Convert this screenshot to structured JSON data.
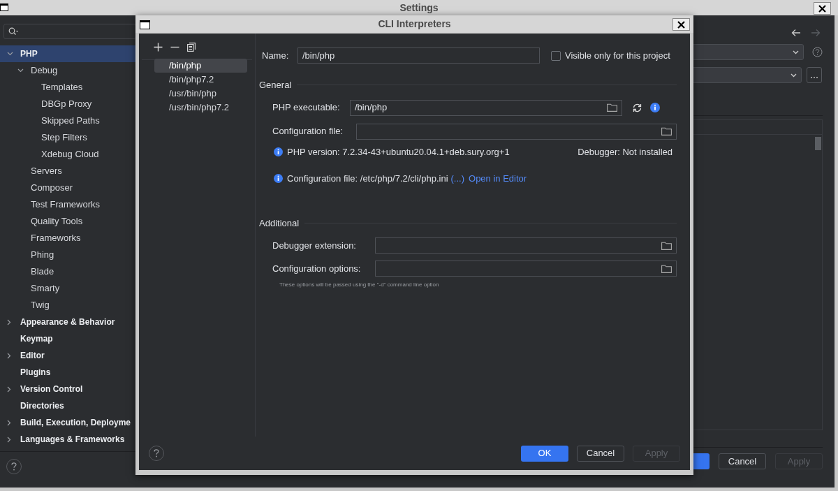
{
  "settings": {
    "title": "Settings",
    "sidebar": {
      "items": [
        {
          "label": "PHP",
          "expanded": true,
          "selected": true,
          "children": [
            {
              "label": "Debug",
              "expanded": true,
              "selected": false,
              "children": [
                {
                  "label": "Templates",
                  "selected": false
                },
                {
                  "label": "DBGp Proxy",
                  "selected": false
                },
                {
                  "label": "Skipped Paths",
                  "selected": false
                },
                {
                  "label": "Step Filters",
                  "selected": false
                },
                {
                  "label": "Xdebug Cloud",
                  "selected": false
                }
              ]
            },
            {
              "label": "Servers",
              "selected": false
            },
            {
              "label": "Composer",
              "selected": false
            },
            {
              "label": "Test Frameworks",
              "selected": false
            },
            {
              "label": "Quality Tools",
              "selected": false
            },
            {
              "label": "Frameworks",
              "selected": false
            },
            {
              "label": "Phing",
              "selected": false
            },
            {
              "label": "Blade",
              "selected": false
            },
            {
              "label": "Smarty",
              "selected": false
            },
            {
              "label": "Twig",
              "selected": false
            }
          ]
        },
        {
          "label": "Appearance & Behavior",
          "expanded": false,
          "selected": false
        },
        {
          "label": "Keymap",
          "selected": false
        },
        {
          "label": "Editor",
          "expanded": false,
          "selected": false
        },
        {
          "label": "Plugins",
          "selected": false
        },
        {
          "label": "Version Control",
          "expanded": false,
          "selected": false
        },
        {
          "label": "Directories",
          "selected": false
        },
        {
          "label": "Build, Execution, Deployme",
          "expanded": false,
          "selected": false
        },
        {
          "label": "Languages & Frameworks",
          "expanded": false,
          "selected": false
        }
      ]
    },
    "buttons": [
      {
        "label": "Cancel",
        "disabled": false
      },
      {
        "label": "Apply",
        "disabled": true
      }
    ]
  },
  "dialog": {
    "title": "CLI Interpreters",
    "interpreters": [
      {
        "label": "/bin/php",
        "selected": true
      },
      {
        "label": "/bin/php7.2",
        "selected": false
      },
      {
        "label": "/usr/bin/php",
        "selected": false
      },
      {
        "label": "/usr/bin/php7.2",
        "selected": false
      }
    ],
    "name": {
      "label": "Name:",
      "value": "/bin/php"
    },
    "visible_only": {
      "label": "Visible only for this project",
      "checked": false
    },
    "general": {
      "title": "General",
      "php_executable": {
        "label": "PHP executable:",
        "value": "/bin/php"
      },
      "configuration_file": {
        "label": "Configuration file:"
      },
      "php_version": "PHP version: 7.2.34-43+ubuntu20.04.1+deb.sury.org+1",
      "debugger": "Debugger: Not installed",
      "config_info": "Configuration file: /etc/php/7.2/cli/php.ini",
      "config_more": "(...)",
      "open_in_editor": "Open in Editor"
    },
    "additional": {
      "title": "Additional",
      "debugger_extension": {
        "label": "Debugger extension:"
      },
      "configuration_options": {
        "label": "Configuration options:"
      },
      "hint": "These options will be passed using the \"-d\" command line option"
    },
    "buttons": [
      {
        "label": "OK",
        "kind": "primary"
      },
      {
        "label": "Cancel",
        "kind": "normal",
        "disabled": false
      },
      {
        "label": "Apply",
        "kind": "normal",
        "disabled": true
      }
    ]
  }
}
